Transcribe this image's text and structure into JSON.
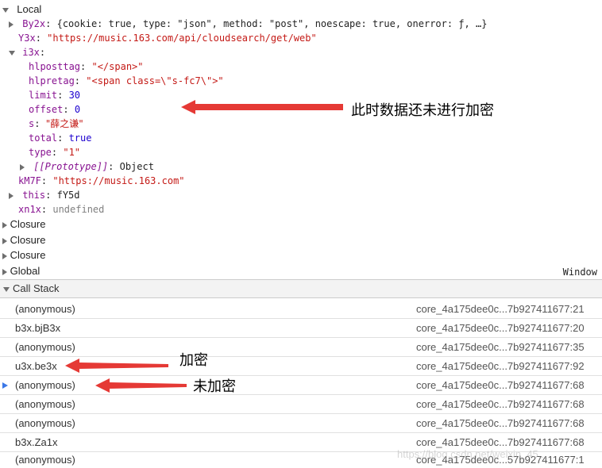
{
  "scope": {
    "local_label": "Local",
    "by2x": {
      "key": "By2x",
      "value": "{cookie: true, type: \"json\", method: \"post\", noescape: true, onerror: ƒ, …}"
    },
    "y3x": {
      "key": "Y3x",
      "value": "\"https://music.163.com/api/cloudsearch/get/web\""
    },
    "i3x": {
      "key": "i3x",
      "value": ""
    },
    "i3x_props": [
      {
        "key": "hlposttag",
        "value": "\"</span>\"",
        "kind": "str"
      },
      {
        "key": "hlpretag",
        "value": "\"<span class=\\\"s-fc7\\\">\"",
        "kind": "str"
      },
      {
        "key": "limit",
        "value": "30",
        "kind": "num"
      },
      {
        "key": "offset",
        "value": "0",
        "kind": "num"
      },
      {
        "key": "s",
        "value": "\"薛之谦\"",
        "kind": "str"
      },
      {
        "key": "total",
        "value": "true",
        "kind": "bool"
      },
      {
        "key": "type",
        "value": "\"1\"",
        "kind": "str"
      }
    ],
    "prototype": {
      "key": "[[Prototype]]",
      "value": "Object"
    },
    "km7f": {
      "key": "kM7F",
      "value": "\"https://music.163.com\""
    },
    "this": {
      "key": "this",
      "value": "fY5d"
    },
    "xn1x": {
      "key": "xn1x",
      "value": "undefined"
    },
    "closures": [
      "Closure",
      "Closure",
      "Closure"
    ],
    "global_label": "Global",
    "window_label": "Window"
  },
  "annotations": {
    "not_encrypted_yet": "此时数据还未进行加密",
    "encrypted": "加密",
    "not_encrypted": "未加密"
  },
  "call_stack": {
    "title": "Call Stack",
    "frames": [
      {
        "fn": "(anonymous)",
        "loc": "core_4a175dee0c...7b927411677:21",
        "current": false
      },
      {
        "fn": "b3x.bjB3x",
        "loc": "core_4a175dee0c...7b927411677:20",
        "current": false
      },
      {
        "fn": "(anonymous)",
        "loc": "core_4a175dee0c...7b927411677:35",
        "current": false
      },
      {
        "fn": "u3x.be3x",
        "loc": "core_4a175dee0c...7b927411677:92",
        "current": false
      },
      {
        "fn": "(anonymous)",
        "loc": "core_4a175dee0c...7b927411677:68",
        "current": true
      },
      {
        "fn": "(anonymous)",
        "loc": "core_4a175dee0c...7b927411677:68",
        "current": false
      },
      {
        "fn": "(anonymous)",
        "loc": "core_4a175dee0c...7b927411677:68",
        "current": false
      },
      {
        "fn": "b3x.Za1x",
        "loc": "core_4a175dee0c...7b927411677:68",
        "current": false
      },
      {
        "fn": "(anonymous)",
        "loc": "core_4a175dee0c...57b927411677:1",
        "current": false
      }
    ]
  },
  "watermark": "https://blog.csdn.net/weixin_45..."
}
